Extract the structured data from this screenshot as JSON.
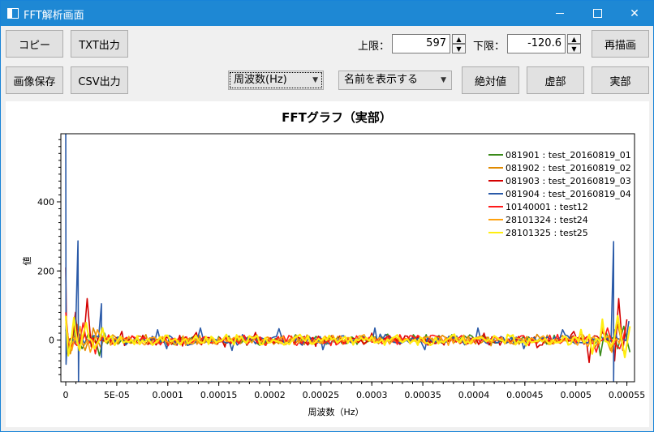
{
  "window": {
    "title": "FFT解析画面"
  },
  "toolbar": {
    "copy_label": "コピー",
    "txt_label": "TXT出力",
    "save_image_label": "画像保存",
    "csv_label": "CSV出力",
    "upper_label": "上限：",
    "upper_value": "597",
    "lower_label": "下限：",
    "lower_value": "-120.6",
    "redraw_label": "再描画",
    "xaxis_select": "周波数(Hz)",
    "legend_select": "名前を表示する",
    "abs_label": "絶対値",
    "imag_label": "虚部",
    "real_label": "実部"
  },
  "chart_data": {
    "type": "line",
    "title": "FFTグラフ（実部）",
    "xlabel": "周波数（Hz）",
    "ylabel": "値",
    "xlim": [
      -4.8e-06,
      0.0005575
    ],
    "ylim": [
      -120.6,
      597
    ],
    "x_ticks": [
      0,
      5e-05,
      0.0001,
      0.00015,
      0.0002,
      0.00025,
      0.0003,
      0.00035,
      0.0004,
      0.00045,
      0.0005,
      0.00055
    ],
    "x_tick_labels": [
      "0",
      "5E-05",
      "0.0001",
      "0.00015",
      "0.0002",
      "0.00025",
      "0.0003",
      "0.00035",
      "0.0004",
      "0.00045",
      "0.0005",
      "0.00055"
    ],
    "y_ticks": [
      0,
      200,
      400
    ],
    "y_tick_labels": [
      "0",
      "200",
      "400"
    ],
    "grid": false,
    "legend_position": "top-right",
    "series": [
      {
        "name": "081901 : test_20160819_01",
        "color": "#3a8a1a",
        "points": [
          [
            0,
            30
          ],
          [
            3.7e-06,
            -35
          ],
          [
            9.5e-06,
            40
          ],
          [
            1.6e-05,
            -25
          ],
          [
            2.2e-05,
            20
          ],
          [
            3.3e-05,
            -45
          ],
          [
            3.8e-05,
            20
          ],
          [
            5.2e-05,
            -10
          ],
          [
            0.000519,
            -10
          ],
          [
            0.000524,
            -45
          ],
          [
            0.00053,
            20
          ],
          [
            0.000541,
            -25
          ],
          [
            0.000547,
            40
          ],
          [
            0.000553,
            -35
          ]
        ]
      },
      {
        "name": "081902 : test_20160819_02",
        "color": "#e08a00",
        "points": [
          [
            0,
            60
          ],
          [
            4.5e-06,
            -40
          ],
          [
            1.15e-05,
            45
          ],
          [
            1.9e-05,
            -30
          ],
          [
            2.7e-05,
            35
          ],
          [
            3.4e-05,
            -20
          ],
          [
            4.6e-05,
            15
          ],
          [
            0.000507,
            15
          ],
          [
            0.000519,
            -20
          ],
          [
            0.000526,
            35
          ],
          [
            0.000534,
            -30
          ],
          [
            0.000541,
            45
          ],
          [
            0.000548,
            -40
          ]
        ]
      },
      {
        "name": "081903 : test_20160819_03",
        "color": "#d40000",
        "points": [
          [
            0,
            210
          ],
          [
            1e-06,
            -40
          ],
          [
            9.5e-06,
            80
          ],
          [
            1.2e-05,
            -10
          ],
          [
            2.1e-05,
            120
          ],
          [
            2.5e-05,
            -20
          ],
          [
            5.5e-05,
            25
          ],
          [
            0.000109,
            -15
          ],
          [
            0.000128,
            22
          ],
          [
            0.000156,
            -20
          ],
          [
            0.000186,
            22
          ],
          [
            0.000245,
            -18
          ],
          [
            0.0003,
            20
          ],
          [
            0.000355,
            -15
          ],
          [
            0.00041,
            20
          ],
          [
            0.000462,
            -22
          ],
          [
            0.000498,
            25
          ],
          [
            0.000513,
            -65
          ],
          [
            0.000526,
            25
          ],
          [
            0.000538,
            -60
          ],
          [
            0.000542,
            120
          ],
          [
            0.000546,
            -30
          ],
          [
            0.00055,
            60
          ]
        ]
      },
      {
        "name": "081904 : test_20160819_04",
        "color": "#2a5aa8",
        "points": [
          [
            0,
            597
          ],
          [
            3e-07,
            -70
          ],
          [
            1.3e-06,
            -10
          ],
          [
            1.2e-05,
            287
          ],
          [
            1.25e-05,
            -120
          ],
          [
            1.3e-05,
            20
          ],
          [
            3.5e-05,
            105
          ],
          [
            3.5e-05,
            -50
          ],
          [
            3.55e-05,
            10
          ],
          [
            9e-05,
            30
          ],
          [
            9.9e-05,
            -25
          ],
          [
            0.000132,
            35
          ],
          [
            0.000163,
            -30
          ],
          [
            0.000209,
            33
          ],
          [
            0.000252,
            -28
          ],
          [
            0.000303,
            35
          ],
          [
            0.000352,
            -28
          ],
          [
            0.000404,
            35
          ],
          [
            0.000449,
            -25
          ],
          [
            0.000487,
            30
          ],
          [
            0.000537,
            285
          ],
          [
            0.000537,
            -120
          ],
          [
            0.0005375,
            30
          ],
          [
            0.000552,
            55
          ]
        ]
      },
      {
        "name": "10140001 : test12",
        "color": "#ff1a1a",
        "points": [
          [
            0,
            80
          ],
          [
            5e-06,
            -20
          ],
          [
            1.7e-05,
            50
          ],
          [
            2.9e-05,
            -40
          ],
          [
            4.2e-05,
            15
          ],
          [
            8.5e-05,
            -12
          ],
          [
            0.000175,
            14
          ],
          [
            0.000265,
            -14
          ],
          [
            0.00036,
            14
          ],
          [
            0.000454,
            -16
          ],
          [
            0.000505,
            18
          ],
          [
            0.00052,
            -35
          ],
          [
            0.000531,
            35
          ],
          [
            0.000543,
            -25
          ],
          [
            0.000549,
            40
          ]
        ]
      },
      {
        "name": "28101324 : test24",
        "color": "#ffa20f",
        "points": [
          [
            0,
            50
          ],
          [
            6e-06,
            -30
          ],
          [
            1.4e-05,
            40
          ],
          [
            2.4e-05,
            -35
          ],
          [
            3.1e-05,
            30
          ],
          [
            4.4e-05,
            -15
          ],
          [
            9.5e-05,
            10
          ],
          [
            0.00019,
            -10
          ],
          [
            0.00029,
            12
          ],
          [
            0.00038,
            -10
          ],
          [
            0.000468,
            12
          ],
          [
            0.000512,
            -18
          ],
          [
            0.000526,
            35
          ],
          [
            0.000535,
            -35
          ],
          [
            0.000545,
            30
          ]
        ]
      },
      {
        "name": "28101325 : test25",
        "color": "#ffee10",
        "points": [
          [
            0,
            70
          ],
          [
            2.5e-06,
            -45
          ],
          [
            8e-06,
            65
          ],
          [
            1.35e-05,
            -30
          ],
          [
            2e-05,
            50
          ],
          [
            2.8e-05,
            -25
          ],
          [
            3.6e-05,
            35
          ],
          [
            4.8e-05,
            -15
          ],
          [
            7e-05,
            12
          ],
          [
            0.00012,
            -10
          ],
          [
            0.00018,
            12
          ],
          [
            0.00024,
            -10
          ],
          [
            0.0003,
            12
          ],
          [
            0.00036,
            -10
          ],
          [
            0.00042,
            12
          ],
          [
            0.000475,
            -12
          ],
          [
            0.000505,
            30
          ],
          [
            0.000516,
            -40
          ],
          [
            0.000526,
            60
          ],
          [
            0.000534,
            -20
          ],
          [
            0.000541,
            70
          ],
          [
            0.000548,
            -50
          ],
          [
            0.000553,
            40
          ]
        ]
      }
    ]
  }
}
